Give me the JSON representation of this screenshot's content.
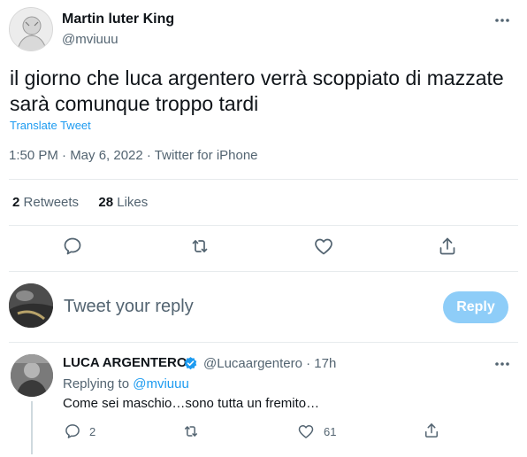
{
  "tweet": {
    "display_name": "Martin luter King",
    "handle": "@mviuuu",
    "text_line1": "il giorno che luca argentero verrà scoppiato di mazzate",
    "text_line2": "sarà comunque troppo tardi",
    "translate_label": "Translate Tweet",
    "meta": "1:50 PM · May 6, 2022 · Twitter for iPhone",
    "retweets_count": "2",
    "retweets_label": "Retweets",
    "likes_count": "28",
    "likes_label": "Likes"
  },
  "composer": {
    "placeholder": "Tweet your reply",
    "reply_button": "Reply"
  },
  "reply": {
    "display_name": "LUCA ARGENTERO",
    "handle_time": "@Lucaargentero · 17h",
    "replying_prefix": "Replying to",
    "replying_handle": "@mviuuu",
    "text": "Come sei maschio…sono tutta un fremito…",
    "reply_count": "2",
    "like_count": "61"
  },
  "icons": [
    "more-icon",
    "reply-icon",
    "retweet-icon",
    "like-icon",
    "share-icon",
    "verified-badge-icon"
  ],
  "colors": {
    "accent": "#1d9bf0",
    "muted": "#536471",
    "reply_button_bg": "#8ecdf8",
    "divider": "#e7ebed"
  }
}
